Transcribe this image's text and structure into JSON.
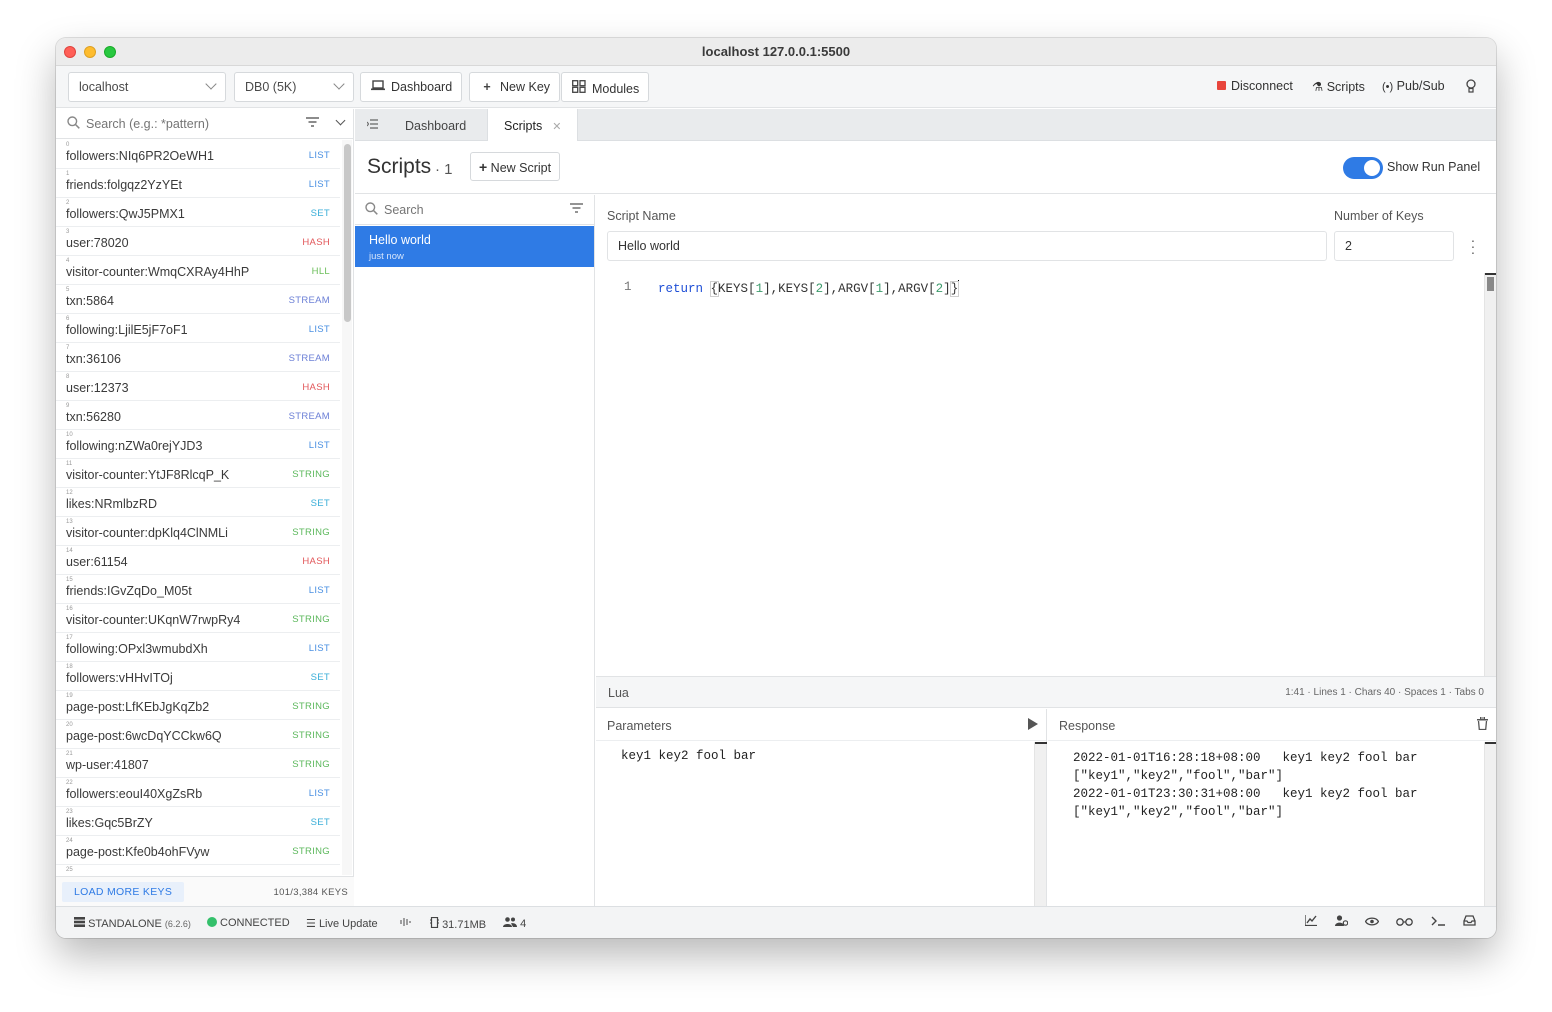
{
  "window": {
    "title": "localhost 127.0.0.1:5500"
  },
  "toolbar": {
    "connection": "localhost",
    "db": "DB0 (5K)",
    "dashboard": "Dashboard",
    "new_key": "New Key",
    "modules": "Modules",
    "disconnect": "Disconnect",
    "scripts": "Scripts",
    "pubsub": "Pub/Sub"
  },
  "keys": {
    "search_placeholder": "Search (e.g.: *pattern)",
    "items": [
      {
        "i": "0",
        "name": "followers:NIq6PR2OeWH1",
        "type": "LIST"
      },
      {
        "i": "1",
        "name": "friends:folgqz2YzYEt",
        "type": "LIST"
      },
      {
        "i": "2",
        "name": "followers:QwJ5PMX1",
        "type": "SET"
      },
      {
        "i": "3",
        "name": "user:78020",
        "type": "HASH"
      },
      {
        "i": "4",
        "name": "visitor-counter:WmqCXRAy4HhP",
        "type": "HLL"
      },
      {
        "i": "5",
        "name": "txn:5864",
        "type": "STREAM"
      },
      {
        "i": "6",
        "name": "following:LjilE5jF7oF1",
        "type": "LIST"
      },
      {
        "i": "7",
        "name": "txn:36106",
        "type": "STREAM"
      },
      {
        "i": "8",
        "name": "user:12373",
        "type": "HASH"
      },
      {
        "i": "9",
        "name": "txn:56280",
        "type": "STREAM"
      },
      {
        "i": "10",
        "name": "following:nZWa0rejYJD3",
        "type": "LIST"
      },
      {
        "i": "11",
        "name": "visitor-counter:YtJF8RlcqP_K",
        "type": "STRING"
      },
      {
        "i": "12",
        "name": "likes:NRmlbzRD",
        "type": "SET"
      },
      {
        "i": "13",
        "name": "visitor-counter:dpKlq4ClNMLi",
        "type": "STRING"
      },
      {
        "i": "14",
        "name": "user:61154",
        "type": "HASH"
      },
      {
        "i": "15",
        "name": "friends:IGvZqDo_M05t",
        "type": "LIST"
      },
      {
        "i": "16",
        "name": "visitor-counter:UKqnW7rwpRy4",
        "type": "STRING"
      },
      {
        "i": "17",
        "name": "following:OPxl3wmubdXh",
        "type": "LIST"
      },
      {
        "i": "18",
        "name": "followers:vHHvITOj",
        "type": "SET"
      },
      {
        "i": "19",
        "name": "page-post:LfKEbJgKqZb2",
        "type": "STRING"
      },
      {
        "i": "20",
        "name": "page-post:6wcDqYCCkw6Q",
        "type": "STRING"
      },
      {
        "i": "21",
        "name": "wp-user:41807",
        "type": "STRING"
      },
      {
        "i": "22",
        "name": "followers:eouI40XgZsRb",
        "type": "LIST"
      },
      {
        "i": "23",
        "name": "likes:Gqc5BrZY",
        "type": "SET"
      },
      {
        "i": "24",
        "name": "page-post:Kfe0b4ohFVyw",
        "type": "STRING"
      },
      {
        "i": "25",
        "name": "",
        "type": ""
      }
    ],
    "load_more": "LOAD MORE KEYS",
    "count": "101/3,384 KEYS"
  },
  "type_colors": {
    "LIST": "#4a90e2",
    "SET": "#3aaed8",
    "HASH": "#e2575a",
    "HLL": "#6cbf5a",
    "STREAM": "#6b7fd6",
    "STRING": "#5cb85c"
  },
  "tabs": [
    {
      "label": "Dashboard"
    },
    {
      "label": "Scripts"
    }
  ],
  "scripts": {
    "title": "Scripts",
    "count": "· 1",
    "new_script": "New Script",
    "show_run_panel": "Show Run Panel",
    "search_placeholder": "Search",
    "list": [
      {
        "name": "Hello world",
        "time": "just now"
      }
    ],
    "script_name_label": "Script Name",
    "script_name": "Hello world",
    "num_keys_label": "Number of Keys",
    "num_keys": "2",
    "code": {
      "line": "1",
      "kw": "return",
      "body_parts": [
        "{",
        "KEYS[",
        "1",
        "],KEYS[",
        "2",
        "],ARGV[",
        "1",
        "],ARGV[",
        "2",
        "]",
        "}"
      ]
    },
    "language": "Lua",
    "editor_stats": "1:41 · Lines 1 · Chars 40 · Spaces 1 · Tabs 0",
    "parameters_label": "Parameters",
    "parameters": "key1 key2 fool bar",
    "response_label": "Response",
    "responses": [
      {
        "time": "2022-01-01T16:28:18+08:00",
        "params": "key1 key2 fool bar",
        "result": "[\"key1\",\"key2\",\"fool\",\"bar\"]"
      },
      {
        "time": "2022-01-01T23:30:31+08:00",
        "params": "key1 key2 fool bar",
        "result": "[\"key1\",\"key2\",\"fool\",\"bar\"]"
      }
    ]
  },
  "statusbar": {
    "mode": "STANDALONE",
    "version": "(6.2.6)",
    "connected": "CONNECTED",
    "live_update": "Live Update",
    "memory": "31.71MB",
    "clients": "4"
  }
}
